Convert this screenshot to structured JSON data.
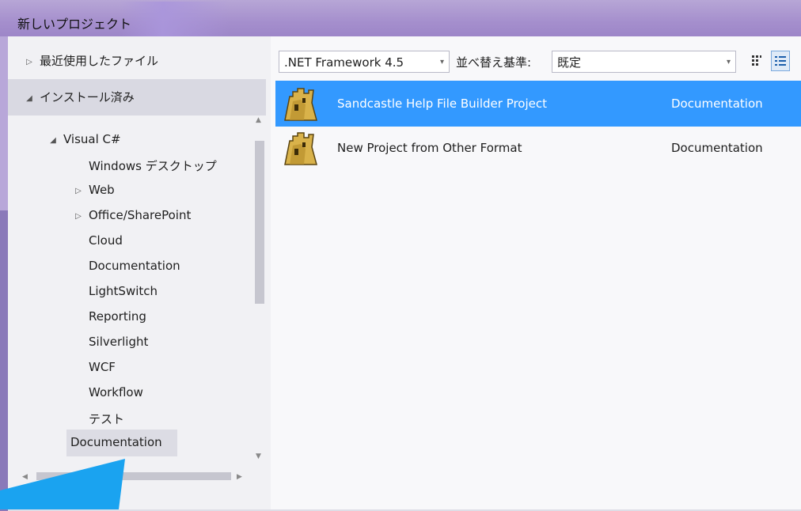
{
  "window": {
    "title": "新しいプロジェクト"
  },
  "tree": {
    "recent": "最近使用したファイル",
    "installed": "インストール済み",
    "visual_cs": "Visual C#",
    "children": [
      {
        "label": "Windows デスクトップ",
        "expand": ""
      },
      {
        "label": "Web",
        "expand": "▷"
      },
      {
        "label": "Office/SharePoint",
        "expand": "▷"
      },
      {
        "label": "Cloud",
        "expand": ""
      },
      {
        "label": "Documentation",
        "expand": ""
      },
      {
        "label": "LightSwitch",
        "expand": ""
      },
      {
        "label": "Reporting",
        "expand": ""
      },
      {
        "label": "Silverlight",
        "expand": ""
      },
      {
        "label": "WCF",
        "expand": ""
      },
      {
        "label": "Workflow",
        "expand": ""
      },
      {
        "label": "テスト",
        "expand": ""
      }
    ],
    "selected": "Documentation"
  },
  "toolbar": {
    "framework": ".NET Framework 4.5",
    "sort_label": "並べ替え基準:",
    "sort_value": "既定"
  },
  "templates": [
    {
      "name": "Sandcastle Help File Builder Project",
      "category": "Documentation",
      "selected": true
    },
    {
      "name": "New Project from Other Format",
      "category": "Documentation",
      "selected": false
    }
  ],
  "icons": {
    "collapsed": "▷",
    "expanded": "◢",
    "dropdown": "▾",
    "scroll_up": "▲",
    "scroll_down": "▼",
    "scroll_left": "◀",
    "scroll_right": "▶"
  },
  "colors": {
    "selection": "#3399ff",
    "titlebar": "#a58fcd"
  }
}
